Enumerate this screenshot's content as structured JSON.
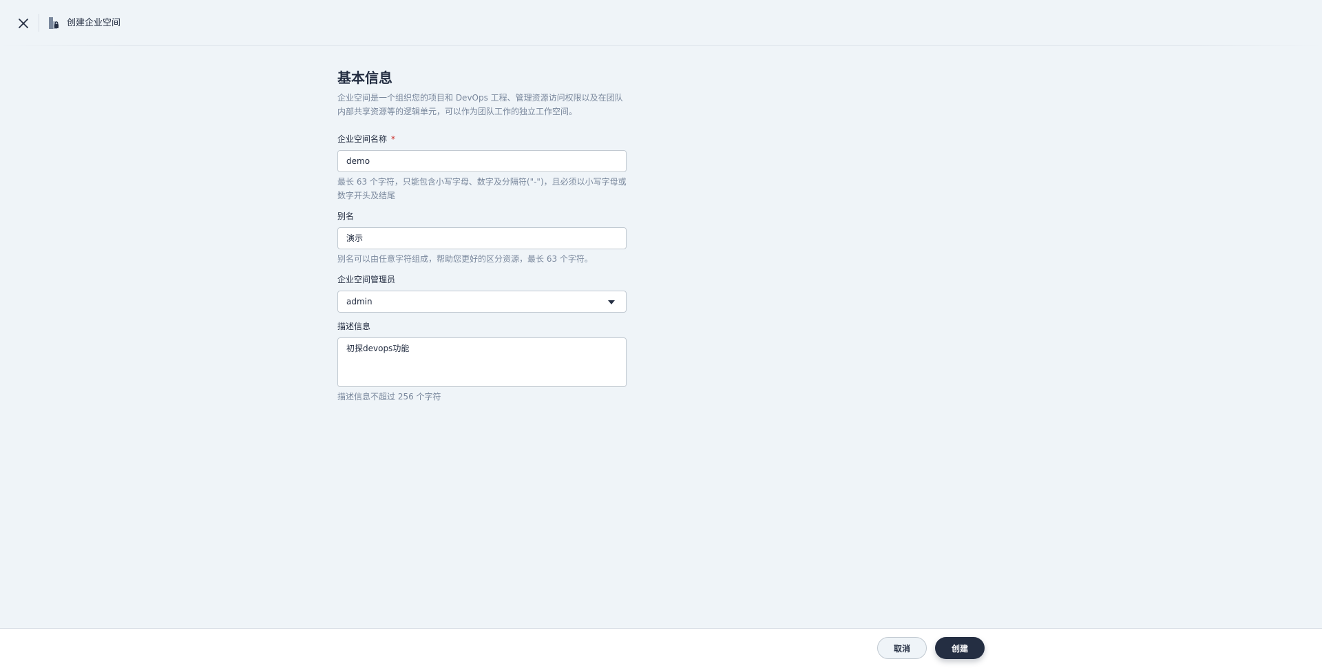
{
  "header": {
    "title": "创建企业空间",
    "close_icon": "close-icon",
    "workspace_icon": "enterprise-space-icon"
  },
  "basic_info": {
    "title": "基本信息",
    "description": "企业空间是一个组织您的项目和 DevOps 工程、管理资源访问权限以及在团队内部共享资源等的逻辑单元，可以作为团队工作的独立工作空间。"
  },
  "fields": {
    "name": {
      "label": "企业空间名称",
      "required_mark": "*",
      "value": "demo",
      "hint": "最长 63 个字符，只能包含小写字母、数字及分隔符(\"-\")，且必须以小写字母或数字开头及结尾"
    },
    "alias": {
      "label": "别名",
      "value": "演示",
      "hint": "别名可以由任意字符组成，帮助您更好的区分资源，最长 63 个字符。"
    },
    "manager": {
      "label": "企业空间管理员",
      "selected": "admin"
    },
    "description": {
      "label": "描述信息",
      "value": "初探devops功能",
      "hint": "描述信息不超过 256 个字符"
    }
  },
  "footer": {
    "cancel_label": "取消",
    "create_label": "创建"
  },
  "colors": {
    "background": "#eff4f8",
    "primary": "#242e42",
    "hint_text": "#79879c",
    "required": "#ca2621",
    "border": "#c1c9d1"
  }
}
